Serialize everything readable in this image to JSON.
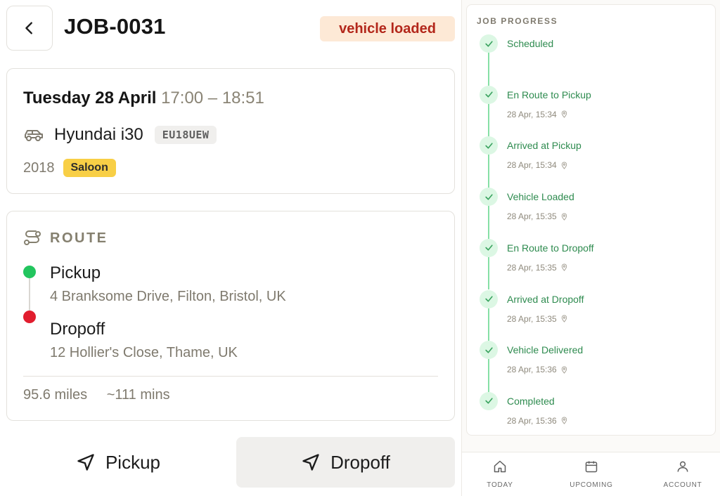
{
  "header": {
    "job_id": "JOB-0031",
    "status": "vehicle loaded"
  },
  "schedule": {
    "date": "Tuesday 28 April",
    "time": "17:00 – 18:51"
  },
  "vehicle": {
    "name": "Hyundai i30",
    "plate": "EU18UEW",
    "year": "2018",
    "body": "Saloon"
  },
  "route": {
    "label": "ROUTE",
    "pickup": {
      "label": "Pickup",
      "address": "4 Branksome Drive, Filton, Bristol, UK"
    },
    "dropoff": {
      "label": "Dropoff",
      "address": "12 Hollier's Close, Thame, UK"
    },
    "distance": "95.6 miles",
    "duration": "~111 mins"
  },
  "actions": {
    "pickup_label": "Pickup",
    "dropoff_label": "Dropoff"
  },
  "progress": {
    "title": "JOB PROGRESS",
    "steps": [
      {
        "name": "Scheduled",
        "time": ""
      },
      {
        "name": "En Route to Pickup",
        "time": "28 Apr, 15:34"
      },
      {
        "name": "Arrived at Pickup",
        "time": "28 Apr, 15:34"
      },
      {
        "name": "Vehicle Loaded",
        "time": "28 Apr, 15:35"
      },
      {
        "name": "En Route to Dropoff",
        "time": "28 Apr, 15:35"
      },
      {
        "name": "Arrived at Dropoff",
        "time": "28 Apr, 15:35"
      },
      {
        "name": "Vehicle Delivered",
        "time": "28 Apr, 15:36"
      },
      {
        "name": "Completed",
        "time": "28 Apr, 15:36"
      }
    ]
  },
  "tabs": [
    {
      "label": "TODAY",
      "icon": "home-icon"
    },
    {
      "label": "UPCOMING",
      "icon": "calendar-icon"
    },
    {
      "label": "ACCOUNT",
      "icon": "user-icon"
    }
  ],
  "colors": {
    "status_bg": "#fde9d6",
    "status_text": "#b3271b",
    "body_badge": "#f8cf46",
    "pickup_dot": "#22c55e",
    "dropoff_dot": "#e11d2e",
    "progress_green": "#2e8b4f"
  }
}
